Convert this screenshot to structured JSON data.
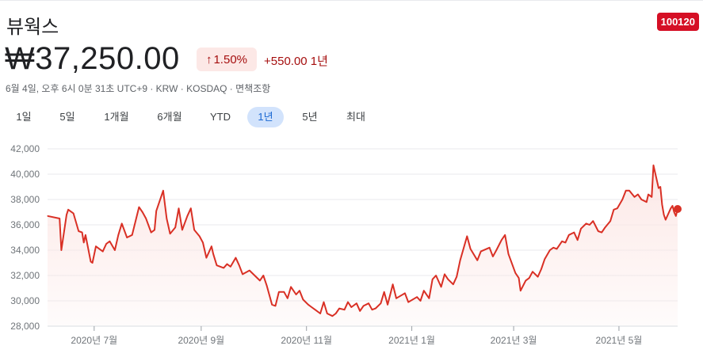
{
  "header": {
    "name": "뷰웍스",
    "ticker": "100120",
    "price": "₩37,250.00",
    "change_pct": "1.50%",
    "change_arrow": "↑",
    "change_abs": "+550.00 1년",
    "meta": "6월 4일, 오후 6시 0분 31초 UTC+9 · KRW · KOSDAQ · 면책조항"
  },
  "tabs": [
    {
      "label": "1일",
      "active": false
    },
    {
      "label": "5일",
      "active": false
    },
    {
      "label": "1개월",
      "active": false
    },
    {
      "label": "6개월",
      "active": false
    },
    {
      "label": "YTD",
      "active": false
    },
    {
      "label": "1년",
      "active": true
    },
    {
      "label": "5년",
      "active": false
    },
    {
      "label": "최대",
      "active": false
    }
  ],
  "chart_data": {
    "type": "area",
    "title": "",
    "xlabel": "",
    "ylabel": "",
    "ylim": [
      28000,
      42000
    ],
    "y_ticks": [
      28000,
      30000,
      32000,
      34000,
      36000,
      38000,
      40000,
      42000
    ],
    "y_tick_labels": [
      "28,000",
      "30,000",
      "32,000",
      "34,000",
      "36,000",
      "38,000",
      "40,000",
      "42,000"
    ],
    "x_tick_labels": [
      "2020년 7월",
      "2020년 9월",
      "2020년 11월",
      "2021년 1월",
      "2021년 3월",
      "2021년 5월"
    ],
    "x_tick_dates": [
      "2020-07-01",
      "2020-09-01",
      "2020-11-01",
      "2021-01-01",
      "2021-03-01",
      "2021-05-01"
    ],
    "x_range": [
      "2020-06-04",
      "2021-06-04"
    ],
    "grid": true,
    "line_color": "#d93025",
    "fill_color": "#fce8e6",
    "series": [
      {
        "values": [
          [
            "2020-06-04",
            36700
          ],
          [
            "2020-06-11",
            36500
          ],
          [
            "2020-06-12",
            34000
          ],
          [
            "2020-06-15",
            36800
          ],
          [
            "2020-06-16",
            37200
          ],
          [
            "2020-06-19",
            36900
          ],
          [
            "2020-06-22",
            35500
          ],
          [
            "2020-06-24",
            35400
          ],
          [
            "2020-06-25",
            34600
          ],
          [
            "2020-06-26",
            35200
          ],
          [
            "2020-06-29",
            33100
          ],
          [
            "2020-06-30",
            33000
          ],
          [
            "2020-07-02",
            34300
          ],
          [
            "2020-07-06",
            33900
          ],
          [
            "2020-07-08",
            34500
          ],
          [
            "2020-07-10",
            34700
          ],
          [
            "2020-07-13",
            34000
          ],
          [
            "2020-07-15",
            35200
          ],
          [
            "2020-07-17",
            36100
          ],
          [
            "2020-07-20",
            35000
          ],
          [
            "2020-07-23",
            35200
          ],
          [
            "2020-07-27",
            37400
          ],
          [
            "2020-07-29",
            37000
          ],
          [
            "2020-07-31",
            36500
          ],
          [
            "2020-08-03",
            35400
          ],
          [
            "2020-08-05",
            35600
          ],
          [
            "2020-08-06",
            37100
          ],
          [
            "2020-08-10",
            38700
          ],
          [
            "2020-08-12",
            36500
          ],
          [
            "2020-08-14",
            35300
          ],
          [
            "2020-08-17",
            35800
          ],
          [
            "2020-08-19",
            37300
          ],
          [
            "2020-08-21",
            35600
          ],
          [
            "2020-08-24",
            36700
          ],
          [
            "2020-08-26",
            37300
          ],
          [
            "2020-08-28",
            35600
          ],
          [
            "2020-08-31",
            35100
          ],
          [
            "2020-09-02",
            34600
          ],
          [
            "2020-09-04",
            33400
          ],
          [
            "2020-09-07",
            34300
          ],
          [
            "2020-09-08",
            33700
          ],
          [
            "2020-09-10",
            32800
          ],
          [
            "2020-09-14",
            32600
          ],
          [
            "2020-09-16",
            32900
          ],
          [
            "2020-09-18",
            32700
          ],
          [
            "2020-09-21",
            33400
          ],
          [
            "2020-09-23",
            32800
          ],
          [
            "2020-09-25",
            32100
          ],
          [
            "2020-09-29",
            32400
          ],
          [
            "2020-10-05",
            31600
          ],
          [
            "2020-10-07",
            32000
          ],
          [
            "2020-10-09",
            31200
          ],
          [
            "2020-10-12",
            29700
          ],
          [
            "2020-10-14",
            29600
          ],
          [
            "2020-10-16",
            30700
          ],
          [
            "2020-10-19",
            30700
          ],
          [
            "2020-10-21",
            30200
          ],
          [
            "2020-10-23",
            31100
          ],
          [
            "2020-10-26",
            30500
          ],
          [
            "2020-10-28",
            30800
          ],
          [
            "2020-10-30",
            30100
          ],
          [
            "2020-11-02",
            29700
          ],
          [
            "2020-11-04",
            29500
          ],
          [
            "2020-11-06",
            29300
          ],
          [
            "2020-11-09",
            29000
          ],
          [
            "2020-11-11",
            29900
          ],
          [
            "2020-11-13",
            29000
          ],
          [
            "2020-11-16",
            28800
          ],
          [
            "2020-11-18",
            29000
          ],
          [
            "2020-11-20",
            29400
          ],
          [
            "2020-11-23",
            29300
          ],
          [
            "2020-11-25",
            29900
          ],
          [
            "2020-11-27",
            29500
          ],
          [
            "2020-11-30",
            29800
          ],
          [
            "2020-12-02",
            29200
          ],
          [
            "2020-12-04",
            29600
          ],
          [
            "2020-12-07",
            29800
          ],
          [
            "2020-12-09",
            29300
          ],
          [
            "2020-12-11",
            29400
          ],
          [
            "2020-12-14",
            29800
          ],
          [
            "2020-12-16",
            30700
          ],
          [
            "2020-12-18",
            29700
          ],
          [
            "2020-12-21",
            31300
          ],
          [
            "2020-12-23",
            30200
          ],
          [
            "2020-12-28",
            30600
          ],
          [
            "2020-12-30",
            29900
          ],
          [
            "2021-01-04",
            30300
          ],
          [
            "2021-01-06",
            30000
          ],
          [
            "2021-01-08",
            30800
          ],
          [
            "2021-01-11",
            30200
          ],
          [
            "2021-01-13",
            31700
          ],
          [
            "2021-01-15",
            32000
          ],
          [
            "2021-01-18",
            31100
          ],
          [
            "2021-01-20",
            32100
          ],
          [
            "2021-01-22",
            31700
          ],
          [
            "2021-01-25",
            31300
          ],
          [
            "2021-01-27",
            31900
          ],
          [
            "2021-01-29",
            33200
          ],
          [
            "2021-02-02",
            35100
          ],
          [
            "2021-02-04",
            34100
          ],
          [
            "2021-02-08",
            33200
          ],
          [
            "2021-02-10",
            33900
          ],
          [
            "2021-02-15",
            34200
          ],
          [
            "2021-02-17",
            33500
          ],
          [
            "2021-02-19",
            34000
          ],
          [
            "2021-02-22",
            34800
          ],
          [
            "2021-02-24",
            35200
          ],
          [
            "2021-02-26",
            33700
          ],
          [
            "2021-03-02",
            32200
          ],
          [
            "2021-03-04",
            31800
          ],
          [
            "2021-03-05",
            30800
          ],
          [
            "2021-03-08",
            31600
          ],
          [
            "2021-03-10",
            31800
          ],
          [
            "2021-03-12",
            32300
          ],
          [
            "2021-03-15",
            31900
          ],
          [
            "2021-03-17",
            32500
          ],
          [
            "2021-03-19",
            33300
          ],
          [
            "2021-03-22",
            34000
          ],
          [
            "2021-03-24",
            34200
          ],
          [
            "2021-03-26",
            34100
          ],
          [
            "2021-03-29",
            34700
          ],
          [
            "2021-03-31",
            34600
          ],
          [
            "2021-04-02",
            35200
          ],
          [
            "2021-04-05",
            35400
          ],
          [
            "2021-04-07",
            34800
          ],
          [
            "2021-04-09",
            35700
          ],
          [
            "2021-04-12",
            36100
          ],
          [
            "2021-04-14",
            36000
          ],
          [
            "2021-04-16",
            36300
          ],
          [
            "2021-04-19",
            35500
          ],
          [
            "2021-04-21",
            35400
          ],
          [
            "2021-04-23",
            35800
          ],
          [
            "2021-04-26",
            36300
          ],
          [
            "2021-04-28",
            37200
          ],
          [
            "2021-04-30",
            37300
          ],
          [
            "2021-05-03",
            38000
          ],
          [
            "2021-05-05",
            38700
          ],
          [
            "2021-05-07",
            38700
          ],
          [
            "2021-05-10",
            38200
          ],
          [
            "2021-05-12",
            38400
          ],
          [
            "2021-05-14",
            38000
          ],
          [
            "2021-05-17",
            37800
          ],
          [
            "2021-05-18",
            38400
          ],
          [
            "2021-05-20",
            38200
          ],
          [
            "2021-05-21",
            40700
          ],
          [
            "2021-05-24",
            38900
          ],
          [
            "2021-05-25",
            39000
          ],
          [
            "2021-05-26",
            37600
          ],
          [
            "2021-05-27",
            36800
          ],
          [
            "2021-05-28",
            36400
          ],
          [
            "2021-05-31",
            37300
          ],
          [
            "2021-06-01",
            37500
          ],
          [
            "2021-06-02",
            37000
          ],
          [
            "2021-06-03",
            36700
          ],
          [
            "2021-06-04",
            37250
          ]
        ]
      }
    ]
  }
}
